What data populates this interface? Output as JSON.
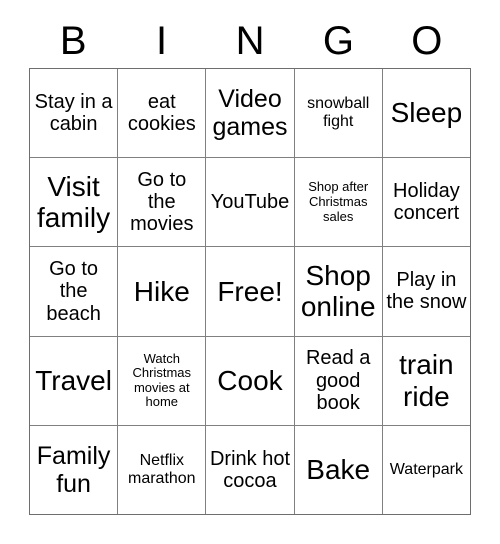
{
  "card": {
    "title_letters": [
      "B",
      "I",
      "N",
      "G",
      "O"
    ],
    "free_space_label": "Free!",
    "colors": {
      "background": "#ffffff",
      "text": "#000000",
      "gridline": "#808080"
    },
    "rows": [
      [
        {
          "text": "Stay in a cabin",
          "size": "md"
        },
        {
          "text": "eat cookies",
          "size": "md"
        },
        {
          "text": "Video games",
          "size": "lg"
        },
        {
          "text": "snowball fight",
          "size": "sm"
        },
        {
          "text": "Sleep",
          "size": "xl"
        }
      ],
      [
        {
          "text": "Visit family",
          "size": "xl"
        },
        {
          "text": "Go to the movies",
          "size": "md"
        },
        {
          "text": "YouTube",
          "size": "md"
        },
        {
          "text": "Shop after Christmas sales",
          "size": "xs"
        },
        {
          "text": "Holiday concert",
          "size": "md"
        }
      ],
      [
        {
          "text": "Go to the beach",
          "size": "md"
        },
        {
          "text": "Hike",
          "size": "xl"
        },
        {
          "text": "Free!",
          "size": "xl"
        },
        {
          "text": "Shop online",
          "size": "xl"
        },
        {
          "text": "Play in the snow",
          "size": "md"
        }
      ],
      [
        {
          "text": "Travel",
          "size": "xl"
        },
        {
          "text": "Watch Christmas movies at home",
          "size": "xs"
        },
        {
          "text": "Cook",
          "size": "xl"
        },
        {
          "text": "Read a good book",
          "size": "md"
        },
        {
          "text": "train ride",
          "size": "xl"
        }
      ],
      [
        {
          "text": "Family fun",
          "size": "lg"
        },
        {
          "text": "Netflix marathon",
          "size": "sm"
        },
        {
          "text": "Drink hot cocoa",
          "size": "md"
        },
        {
          "text": "Bake",
          "size": "xl"
        },
        {
          "text": "Waterpark",
          "size": "sm"
        }
      ]
    ]
  }
}
